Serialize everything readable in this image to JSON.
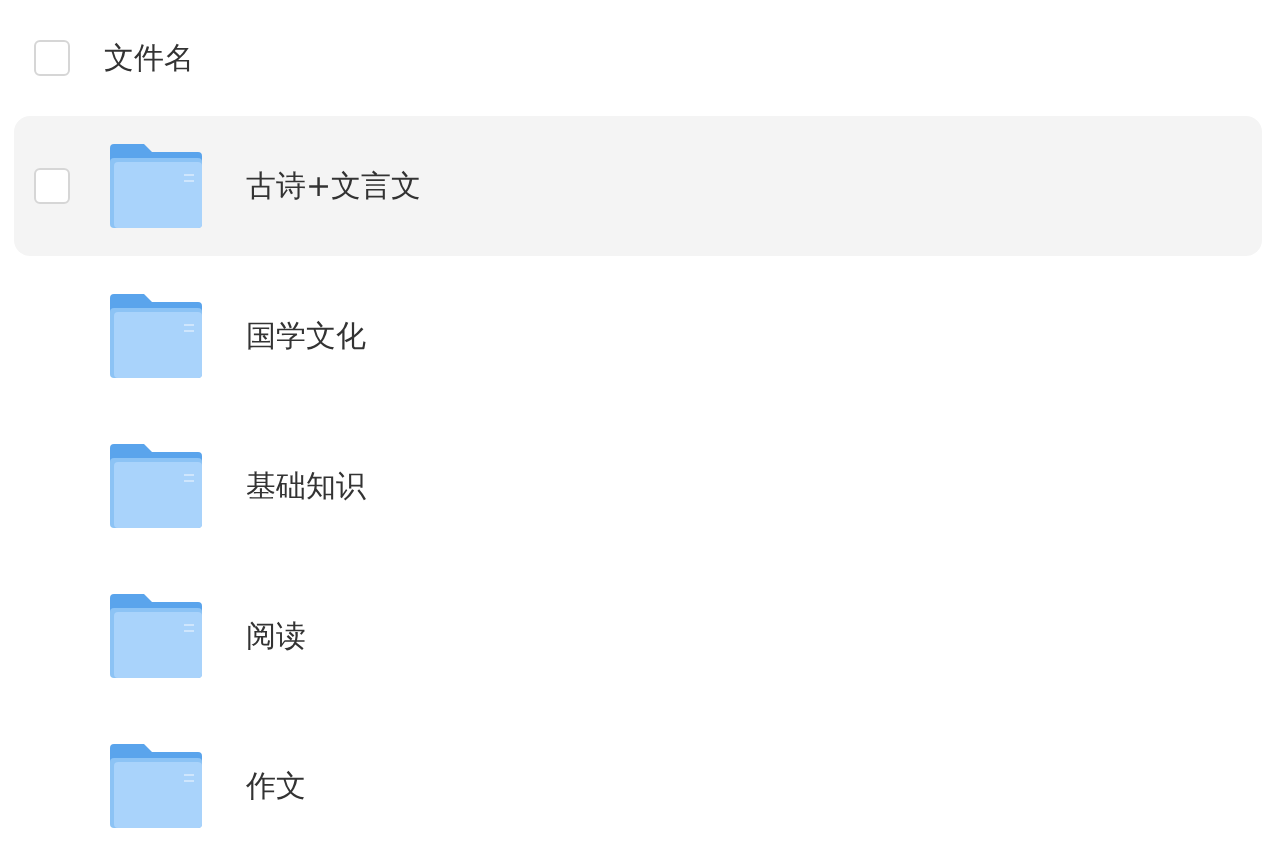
{
  "header": {
    "label": "文件名",
    "checked": false
  },
  "folders": [
    {
      "name": "古诗+文言文",
      "hovered": true,
      "checked": false
    },
    {
      "name": "国学文化",
      "hovered": false,
      "checked": false
    },
    {
      "name": "基础知识",
      "hovered": false,
      "checked": false
    },
    {
      "name": "阅读",
      "hovered": false,
      "checked": false
    },
    {
      "name": "作文",
      "hovered": false,
      "checked": false
    }
  ]
}
